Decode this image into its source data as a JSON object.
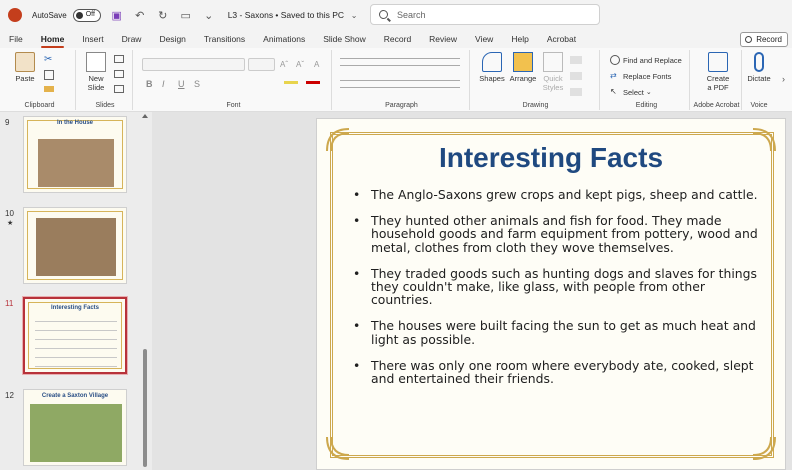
{
  "titlebar": {
    "autosave_label": "AutoSave",
    "autosave_state": "Off",
    "document_title": "L3 - Saxons • Saved to this PC",
    "search_placeholder": "Search"
  },
  "menu": {
    "items": [
      "File",
      "Home",
      "Insert",
      "Draw",
      "Design",
      "Transitions",
      "Animations",
      "Slide Show",
      "Record",
      "Review",
      "View",
      "Help",
      "Acrobat"
    ],
    "active": "Home",
    "record_button": "Record"
  },
  "ribbon": {
    "clipboard": {
      "paste": "Paste",
      "label": "Clipboard"
    },
    "slides": {
      "new_slide_line1": "New",
      "new_slide_line2": "Slide",
      "label": "Slides"
    },
    "font": {
      "label": "Font",
      "bold": "B",
      "italic": "I",
      "underline": "U",
      "strike": "S"
    },
    "paragraph": {
      "label": "Paragraph"
    },
    "drawing": {
      "shapes": "Shapes",
      "arrange": "Arrange",
      "quick_styles_line1": "Quick",
      "quick_styles_line2": "Styles",
      "label": "Drawing"
    },
    "editing": {
      "find_replace": "Find and Replace",
      "replace_fonts": "Replace Fonts",
      "select": "Select",
      "label": "Editing"
    },
    "acrobat": {
      "create_pdf_line1": "Create",
      "create_pdf_line2": "a PDF",
      "label": "Adobe Acrobat"
    },
    "voice": {
      "dictate": "Dictate",
      "label": "Voice"
    }
  },
  "thumbnails": [
    {
      "number": "9",
      "title": "In the House",
      "starred": false,
      "selected": false
    },
    {
      "number": "10",
      "title": "",
      "starred": true,
      "selected": false
    },
    {
      "number": "11",
      "title": "Interesting Facts",
      "starred": false,
      "selected": true
    },
    {
      "number": "12",
      "title": "Create a Saxton Village",
      "starred": false,
      "selected": false
    }
  ],
  "slide": {
    "title": "Interesting Facts",
    "bullets": [
      "The Anglo-Saxons grew crops and kept pigs, sheep and cattle.",
      "They hunted other animals and fish for food. They made household goods and farm equipment from pottery, wood and metal, clothes from cloth they wove themselves.",
      "They traded goods such as hunting dogs and slaves for things they couldn't make, like glass, with people from other countries.",
      "The houses were built facing the sun to get as much heat and light as possible.",
      "There was only one room where everybody ate, cooked, slept and entertained their friends."
    ]
  },
  "colors": {
    "accent": "#c43e1c",
    "title_blue": "#1f4980",
    "frame_gold": "#cda84e",
    "selected_thumb_border": "#b7323a"
  }
}
